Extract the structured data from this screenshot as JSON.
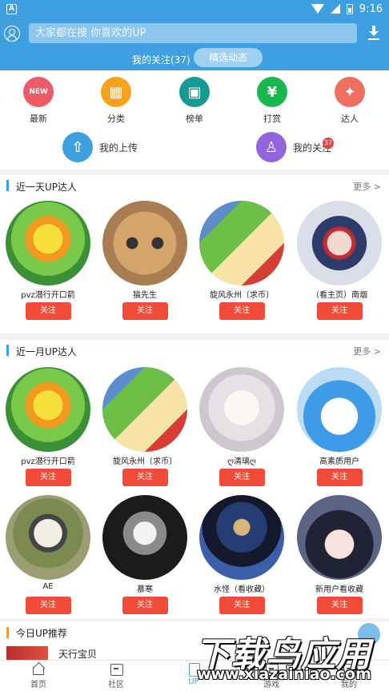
{
  "status_bar": {
    "app_badge": "A",
    "time": "9:16"
  },
  "header": {
    "search_placeholder": "大家都在搜 你喜欢的UP",
    "follow_count": "我的关注(37)",
    "featured_button": "精选动态"
  },
  "quick_menu": {
    "items": [
      {
        "label": "最新",
        "icon": "new-icon",
        "color": "#ec5b67",
        "glyph": "NEW"
      },
      {
        "label": "分类",
        "icon": "category-icon",
        "color": "#f7a21b",
        "glyph": "▦"
      },
      {
        "label": "榜单",
        "icon": "ranking-icon",
        "color": "#159b94",
        "glyph": "▣"
      },
      {
        "label": "打赏",
        "icon": "reward-icon",
        "color": "#18b84f",
        "glyph": "¥"
      },
      {
        "label": "达人",
        "icon": "expert-icon",
        "color": "#ed6f5f",
        "glyph": "✦"
      }
    ],
    "wide_items": [
      {
        "label": "我的上传",
        "icon": "upload-icon",
        "color": "#3ea0e0",
        "glyph": "⇧"
      },
      {
        "label": "我的关注",
        "icon": "following-icon",
        "color": "#9265dc",
        "glyph": "♙",
        "badge": "37"
      }
    ]
  },
  "section_day": {
    "title": "近一天UP达人",
    "more": "更多 >",
    "cards": [
      {
        "name": "pvz潜行开口箭",
        "button": "关注"
      },
      {
        "name": "猫先生",
        "button": "关注"
      },
      {
        "name": "旋风永州〔求币〕",
        "button": "关注"
      },
      {
        "name": "（看主页）南烟",
        "button": "关注"
      }
    ]
  },
  "section_month": {
    "title": "近一月UP达人",
    "more": "更多 >",
    "cards": [
      {
        "name": "pvz潜行开口箭",
        "button": "关注"
      },
      {
        "name": "旋风永州〔求币〕",
        "button": "关注"
      },
      {
        "name": "ღ清璃ღ",
        "button": "关注"
      },
      {
        "name": "高素质用户",
        "button": "关注"
      },
      {
        "name": "AE",
        "button": "关注"
      },
      {
        "name": "慕寒",
        "button": "关注"
      },
      {
        "name": "水怪（看收藏）",
        "button": "关注"
      },
      {
        "name": "新用户看收藏",
        "button": "关注"
      }
    ]
  },
  "recommend": {
    "title": "今日UP推荐",
    "first_item": "天行宝贝"
  },
  "tabbar": {
    "tabs": [
      {
        "label": "首页"
      },
      {
        "label": "社区"
      },
      {
        "label": "UP"
      },
      {
        "label": "游戏"
      },
      {
        "label": "我的"
      }
    ]
  },
  "watermark": {
    "text": "下载鸟应用",
    "url": "www.xiazainiao.com"
  }
}
